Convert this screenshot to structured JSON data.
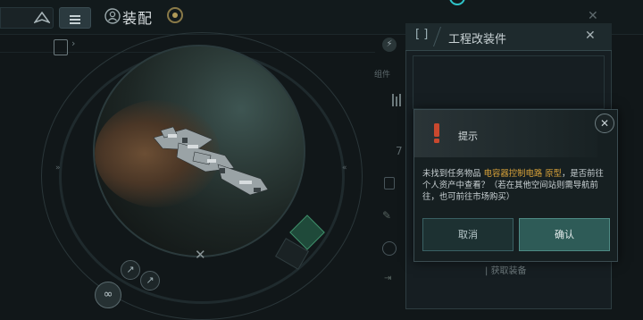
{
  "header": {
    "title": "装配"
  },
  "engineering_panel": {
    "title": "工程改装件",
    "get_equipment_label": "获取装备"
  },
  "side_panel": {
    "label": "组件",
    "number": "7"
  },
  "dialog": {
    "title": "提示",
    "message_prefix": "未找到任务物品 ",
    "item_name": "电容器控制电路 原型",
    "message_suffix": "，是否前往个人资产中查看？（若在其他空间站则需导航前往，也可前往市场购买）",
    "cancel_label": "取消",
    "confirm_label": "确认"
  },
  "colors": {
    "accent_cyan": "#2fc4c9",
    "highlight_orange": "#d8a23a",
    "warning_red": "#c9482e",
    "confirm_green": "#2e5b57"
  },
  "icons": {
    "nav": "ship-nav-icon",
    "menu": "menu-icon",
    "fitting": "fitting-person-icon",
    "warning": "warning-exclamation-icon"
  }
}
